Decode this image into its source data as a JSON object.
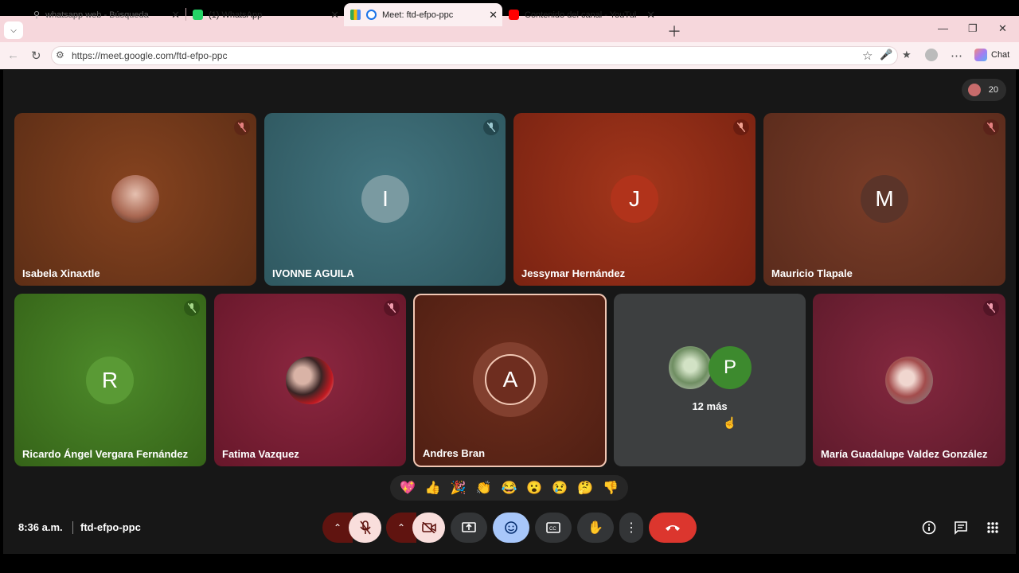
{
  "browser": {
    "tabs": [
      {
        "label": "whatsapp web - Búsqueda",
        "icon": "search-icon",
        "active": false
      },
      {
        "label": "(1) WhatsApp",
        "icon": "whatsapp-icon",
        "active": false
      },
      {
        "label": "Meet: ftd-efpo-ppc",
        "icon": "meet-icon",
        "active": true
      },
      {
        "label": "Contenido del canal - YouTube Stu",
        "icon": "youtube-icon",
        "active": false
      }
    ],
    "url": "https://meet.google.com/ftd-efpo-ppc",
    "chat_label": "Chat"
  },
  "meet": {
    "participant_count": "20",
    "time": "8:36 a.m.",
    "meeting_code": "ftd-efpo-ppc",
    "tiles_row1": [
      {
        "name": "Isabela Xinaxtle",
        "initial": "",
        "kind": "photo",
        "bg": "#6e3519",
        "muted": true
      },
      {
        "name": "IVONNE AGUILA",
        "initial": "I",
        "kind": "letter",
        "bg": "#3b6770",
        "avatar_color": "#7a9aa1",
        "muted": true
      },
      {
        "name": "Jessymar Hernández",
        "initial": "J",
        "kind": "letter",
        "bg": "#8a2a17",
        "avatar_color": "#b1331b",
        "muted": true
      },
      {
        "name": "Mauricio Tlapale",
        "initial": "M",
        "kind": "letter",
        "bg": "#6a3323",
        "avatar_color": "#5b3429",
        "muted": true
      }
    ],
    "tiles_row2": [
      {
        "name": "Ricardo Ángel Vergara Fernández",
        "initial": "R",
        "kind": "letter",
        "bg": "#3f7522",
        "avatar_color": "#5a9a35",
        "muted": true
      },
      {
        "name": "Fatima Vazquez",
        "initial": "",
        "kind": "photo",
        "bg": "#7a1f33",
        "muted": true
      },
      {
        "name": "Andres Bran",
        "initial": "A",
        "kind": "letter",
        "bg": "#5e2618",
        "avatar_color": "#6e2d1f",
        "muted": false,
        "speaking": true
      },
      {
        "name": "",
        "initial": "P",
        "kind": "more",
        "bg": "#3d3f40",
        "avatar_color": "#3d8a2e",
        "more_label": "12 más",
        "muted": false
      },
      {
        "name": "María Guadalupe Valdez González",
        "initial": "",
        "kind": "photo",
        "bg": "#6e1f35",
        "muted": true
      }
    ],
    "reactions": [
      "💖",
      "👍",
      "🎉",
      "👏",
      "😂",
      "😮",
      "😢",
      "🤔",
      "👎"
    ],
    "colors": {
      "end_call": "#dc362e",
      "mic_off": "#f9dedc",
      "accent_active": "#a8c7fa",
      "dark_red": "#601410"
    }
  }
}
